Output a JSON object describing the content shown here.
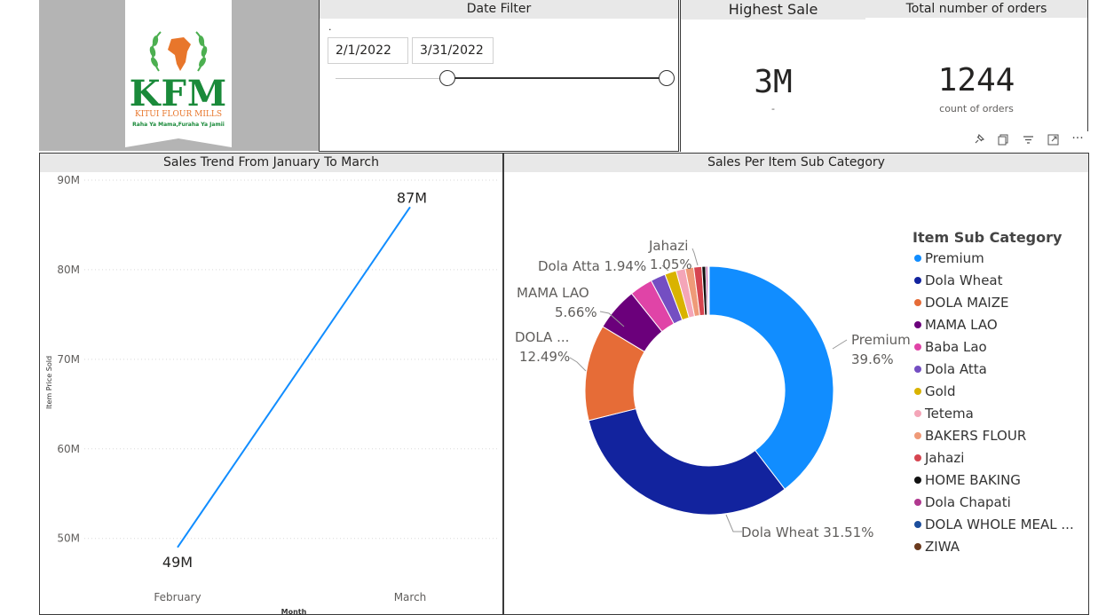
{
  "logo": {
    "letters": "KFM",
    "company": "KITUI FLOUR MILLS",
    "tagline": "Raha Ya Mama,Furaha Ya Jamii"
  },
  "date_filter": {
    "title": "Date Filter",
    "start": "2/1/2022",
    "end": "3/31/2022",
    "dot": "."
  },
  "highest_sale": {
    "title": "Highest Sale",
    "value": "3M",
    "sub": "-"
  },
  "total_orders": {
    "title": "Total number of orders",
    "value": "1244",
    "sub": "count of orders"
  },
  "visual_toolbar": [
    "pin-icon",
    "copy-icon",
    "filter-icon",
    "focus-mode-icon",
    "more-options-icon"
  ],
  "line_chart": {
    "title": "Sales Trend From January To March",
    "ylabel": "Item Price Sold",
    "xlabel": "Month",
    "y_ticks": [
      "90M",
      "80M",
      "70M",
      "60M",
      "50M"
    ],
    "x_labels": [
      "February",
      "March"
    ],
    "data_labels": [
      "49M",
      "87M"
    ],
    "line_color": "#118DFF"
  },
  "donut_chart": {
    "title": "Sales Per Item Sub Category",
    "legend_title": "Item Sub Category",
    "callouts": {
      "premium": [
        "Premium",
        "39.6%"
      ],
      "dola_wheat": "Dola Wheat 31.51%",
      "dola_maize": [
        "DOLA ...",
        "12.49%"
      ],
      "mama_lao": [
        "MAMA LAO",
        "5.66%"
      ],
      "dola_atta": "Dola Atta 1.94%",
      "jahazi": [
        "Jahazi",
        "1.05%"
      ]
    },
    "legend": [
      {
        "label": "Premium",
        "color": "#118DFF"
      },
      {
        "label": "Dola Wheat",
        "color": "#12239E"
      },
      {
        "label": "DOLA MAIZE",
        "color": "#E66C37"
      },
      {
        "label": "MAMA LAO",
        "color": "#6B007B"
      },
      {
        "label": "Baba Lao",
        "color": "#E044A7"
      },
      {
        "label": "Dola Atta",
        "color": "#744EC2"
      },
      {
        "label": "Gold",
        "color": "#D9B300"
      },
      {
        "label": "Tetema",
        "color": "#F4A5B8"
      },
      {
        "label": "BAKERS FLOUR",
        "color": "#EF9A78"
      },
      {
        "label": "Jahazi",
        "color": "#D64550"
      },
      {
        "label": "HOME BAKING",
        "color": "#111111"
      },
      {
        "label": "Dola Chapati",
        "color": "#B0388F"
      },
      {
        "label": "DOLA WHOLE MEAL ...",
        "color": "#1C4E9C"
      },
      {
        "label": "ZIWA",
        "color": "#6B3A1E"
      }
    ]
  },
  "chart_data": [
    {
      "type": "line",
      "title": "Sales Trend From January To March",
      "xlabel": "Month",
      "ylabel": "Item Price Sold",
      "categories": [
        "February",
        "March"
      ],
      "values": [
        49000000,
        87000000
      ],
      "ylim": [
        47000000,
        90000000
      ],
      "grid": true
    },
    {
      "type": "pie",
      "title": "Sales Per Item Sub Category",
      "legend_title": "Item Sub Category",
      "legend_position": "right",
      "categories": [
        "Premium",
        "Dola Wheat",
        "DOLA MAIZE",
        "MAMA LAO",
        "Baba Lao",
        "Dola Atta",
        "Gold",
        "Tetema",
        "BAKERS FLOUR",
        "Jahazi",
        "HOME BAKING",
        "Dola Chapati",
        "DOLA WHOLE MEAL ...",
        "ZIWA"
      ],
      "values": [
        39.6,
        31.51,
        12.49,
        5.66,
        3.0,
        1.94,
        1.5,
        1.2,
        1.1,
        1.05,
        0.5,
        0.25,
        0.12,
        0.08
      ]
    }
  ]
}
